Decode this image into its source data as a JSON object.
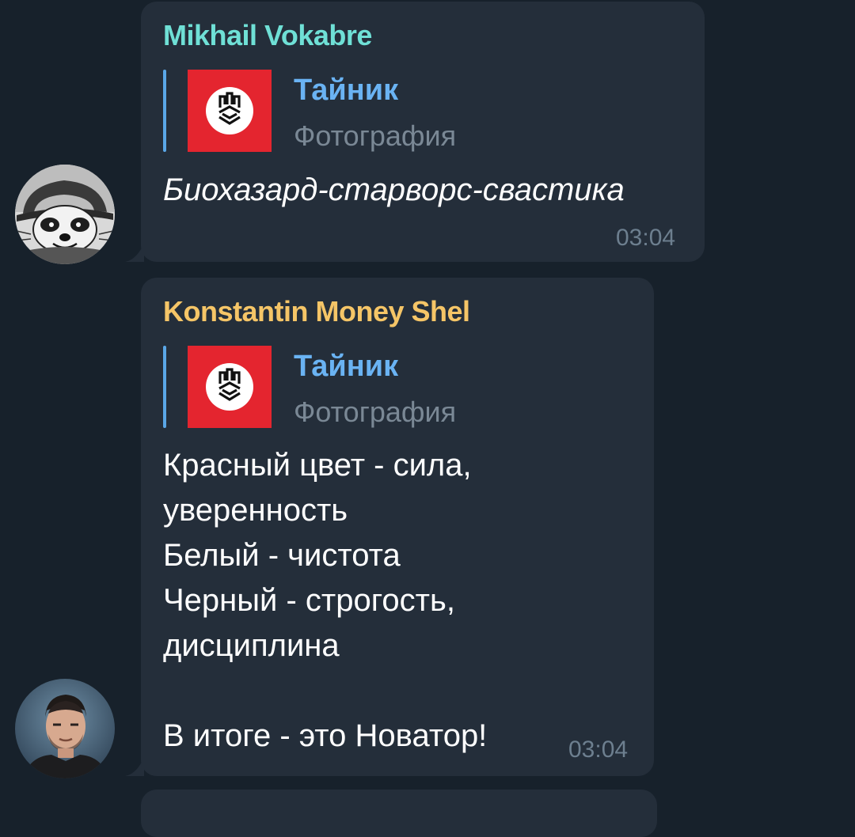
{
  "messages": [
    {
      "sender": "Mikhail Vokabre",
      "sender_color": "#6fe0d6",
      "reply": {
        "title": "Тайник",
        "subtitle": "Фотография",
        "thumb_color": "#e4252f"
      },
      "text": "Биохазард-старворс-свастика",
      "time": "03:04"
    },
    {
      "sender": "Konstantin Money Shel",
      "sender_color": "#f5c567",
      "reply": {
        "title": "Тайник",
        "subtitle": "Фотография",
        "thumb_color": "#e4252f"
      },
      "lines": [
        "Красный цвет - сила,",
        "уверенность",
        "Белый - чистота",
        "Черный - строгость,",
        "дисциплина",
        "",
        "В итоге - это Новатор!"
      ],
      "time": "03:04"
    }
  ],
  "colors": {
    "background": "#17212b",
    "bubble": "#242e3a",
    "reply_bar": "#5aa7e7",
    "reply_title": "#6ab3f3",
    "muted": "#7a8895"
  }
}
